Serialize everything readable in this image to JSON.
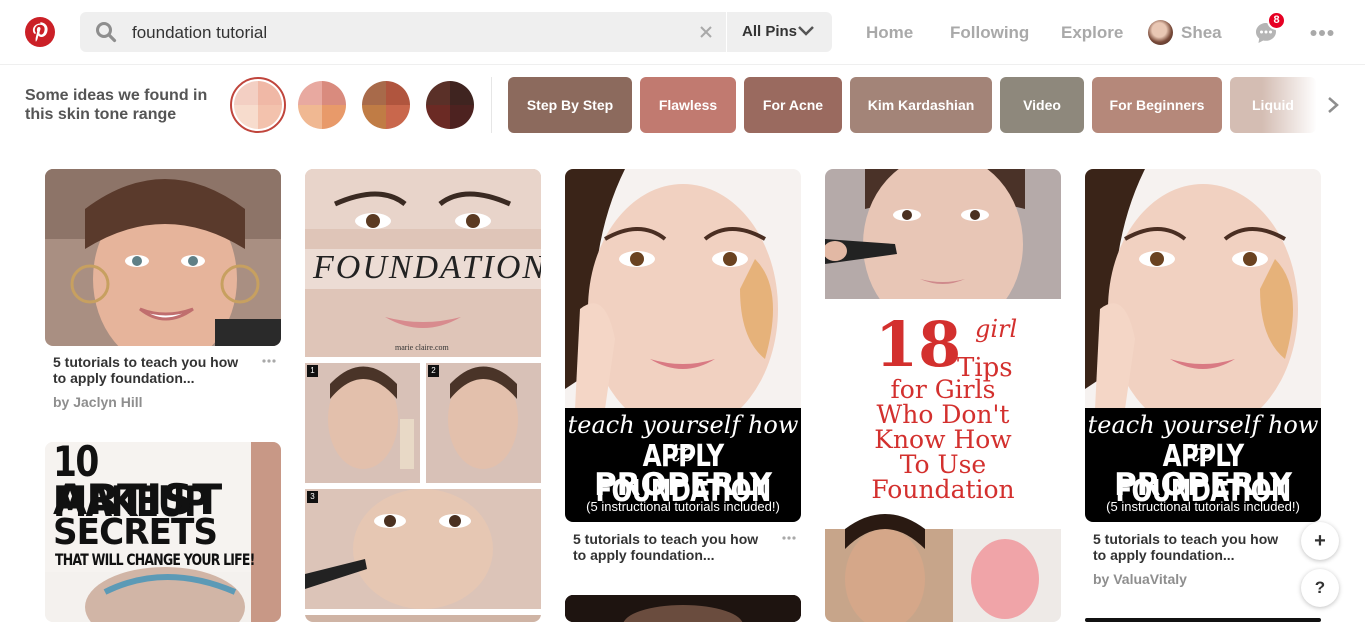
{
  "header": {
    "search_query": "foundation tutorial",
    "scope": "All Pins",
    "nav": {
      "home": "Home",
      "following": "Following",
      "explore": "Explore",
      "profile": "Shea"
    },
    "notification_count": "8",
    "brand_color": "#cb2027"
  },
  "guide": {
    "label": "Some ideas we found in this skin tone range",
    "skin_tones": [
      "light",
      "light-medium",
      "medium",
      "deep"
    ],
    "chips": [
      {
        "label": "Step By Step",
        "color": "#8c6a5d"
      },
      {
        "label": "Flawless",
        "color": "#c17a70"
      },
      {
        "label": "For Acne",
        "color": "#9a6a5f"
      },
      {
        "label": "Kim Kardashian",
        "color": "#a38478"
      },
      {
        "label": "Video",
        "color": "#8e887c"
      },
      {
        "label": "For Beginners",
        "color": "#b5887a"
      },
      {
        "label": "Liquid",
        "color": "#d4bdb3"
      }
    ]
  },
  "pins": [
    {
      "title": "5 tutorials to teach you how to apply foundation...",
      "by": "by Jaclyn Hill"
    },
    {
      "image_text": [
        "10 MAKEUP",
        "ARTIST",
        "SECRETS",
        "THAT WILL CHANGE YOUR LIFE!"
      ]
    },
    {
      "image_text": [
        "FOUNDATION",
        "marie claire.com",
        "1",
        "2",
        "3"
      ]
    },
    {
      "image_text": [
        "teach yourself how to",
        "APPLY FOUNDATION",
        "PROPERLY",
        "(5 instructional tutorials included!)"
      ],
      "title": "5 tutorials to teach you how to apply foundation..."
    },
    {
      "image_text": [
        "18",
        "girl",
        "Tips",
        "for Girls",
        "Who Don't",
        "Know How",
        "To Use",
        "Foundation"
      ]
    },
    {
      "image_text": [
        "teach yourself how to",
        "APPLY FOUNDATION",
        "PROPERLY",
        "(5 instructional tutorials included!)"
      ],
      "title": "5 tutorials to teach you how to apply foundation...",
      "by": "by ValuaVitaly"
    }
  ],
  "floating": {
    "add": "+",
    "help": "?"
  }
}
